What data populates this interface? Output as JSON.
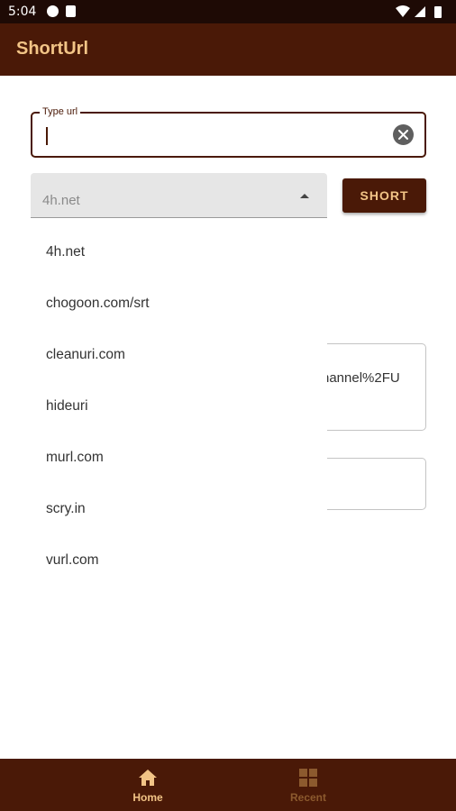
{
  "status_bar": {
    "time": "5:04"
  },
  "app_bar": {
    "title": "ShortUrl"
  },
  "url_input": {
    "label": "Type url",
    "value": ""
  },
  "service_select": {
    "selected": "4h.net",
    "options": [
      "4h.net",
      "chogoon.com/srt",
      "cleanuri.com",
      "hideuri",
      "murl.com",
      "scry.in",
      "vurl.com"
    ]
  },
  "short_button": {
    "label": "SHORT"
  },
  "output": {
    "partial_text": "hannel%2FU"
  },
  "bottom_nav": {
    "home": "Home",
    "recent": "Recent"
  },
  "colors": {
    "primary": "#4a1907",
    "accent": "#f2c486",
    "status_bar": "#1e0a05"
  }
}
